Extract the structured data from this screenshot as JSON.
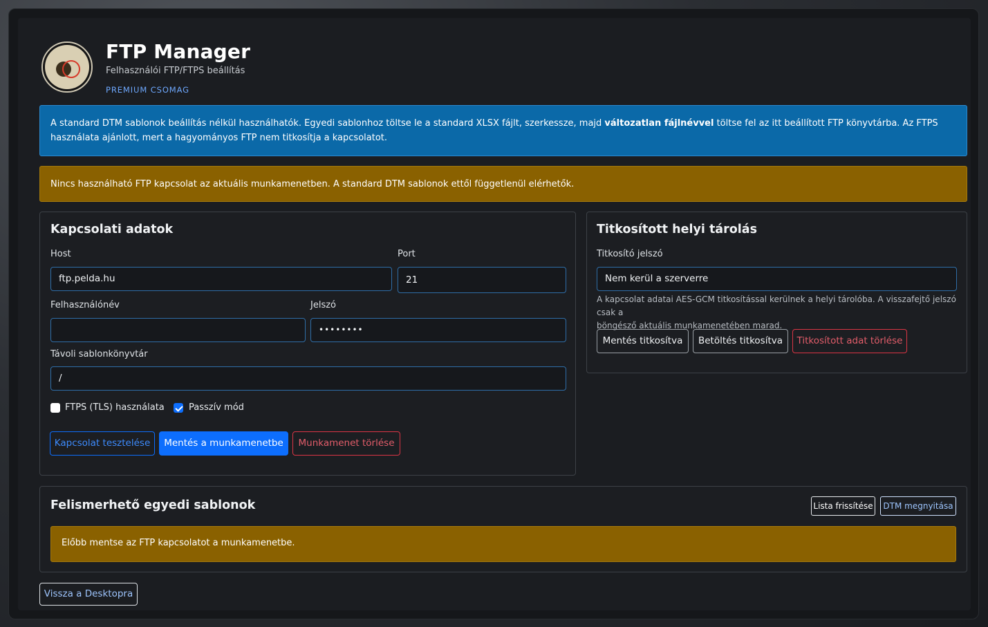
{
  "header": {
    "title": "FTP Manager",
    "subtitle": "Felhasználói FTP/FTPS beállítás",
    "badge": "PREMIUM CSOMAG"
  },
  "alerts": {
    "info_part1": "A standard DTM sablonok beállítás nélkül használhatók. Egyedi sablonhoz töltse le a standard XLSX fájlt, szerkessze, majd ",
    "info_bold": "változatlan fájlnévvel",
    "info_part2": " töltse fel az itt beállított FTP könyvtárba. Az FTPS használata ajánlott, mert a hagyományos FTP nem titkosítja a kapcsolatot.",
    "warning": "Nincs használható FTP kapcsolat az aktuális munkamenetben. A standard DTM sablonok ettől függetlenül elérhetők."
  },
  "connection": {
    "title": "Kapcsolati adatok",
    "host_label": "Host",
    "host_value": "ftp.pelda.hu",
    "port_label": "Port",
    "port_value": "21",
    "username_label": "Felhasználónév",
    "username_value": "",
    "password_label": "Jelszó",
    "password_value": "••••••••",
    "remote_dir_label": "Távoli sablonkönyvtár",
    "remote_dir_value": "/",
    "ftps_label": "FTPS (TLS) használata",
    "ftps_checked": false,
    "passive_label": "Passzív mód",
    "passive_checked": true,
    "test_button": "Kapcsolat tesztelése",
    "save_button": "Mentés a munkamenetbe",
    "clear_button": "Munkamenet törlése"
  },
  "encrypted": {
    "title": "Titkosított helyi tárolás",
    "password_label": "Titkosító jelszó",
    "password_value": "Nem kerül a szerverre",
    "help_line1": "A kapcsolat adatai AES-GCM titkosítással kerülnek a helyi tárolóba. A visszafejtő jelszó csak a",
    "help_line2": "böngésző aktuális munkamenetében marad.",
    "save_button": "Mentés titkosítva",
    "load_button": "Betöltés titkosítva",
    "delete_button": "Titkosított adat törlése"
  },
  "templates": {
    "title": "Felismerhető egyedi sablonok",
    "refresh_button": "Lista frissítése",
    "open_dtm_button": "DTM megnyitása",
    "notice": "Előbb mentse az FTP kapcsolatot a munkamenetbe."
  },
  "footer": {
    "back_button": "Vissza a Desktopra"
  },
  "colors": {
    "info": "#0b69a8",
    "warning": "#8a6100",
    "primary": "#0d6efd",
    "danger": "#dc3545"
  }
}
